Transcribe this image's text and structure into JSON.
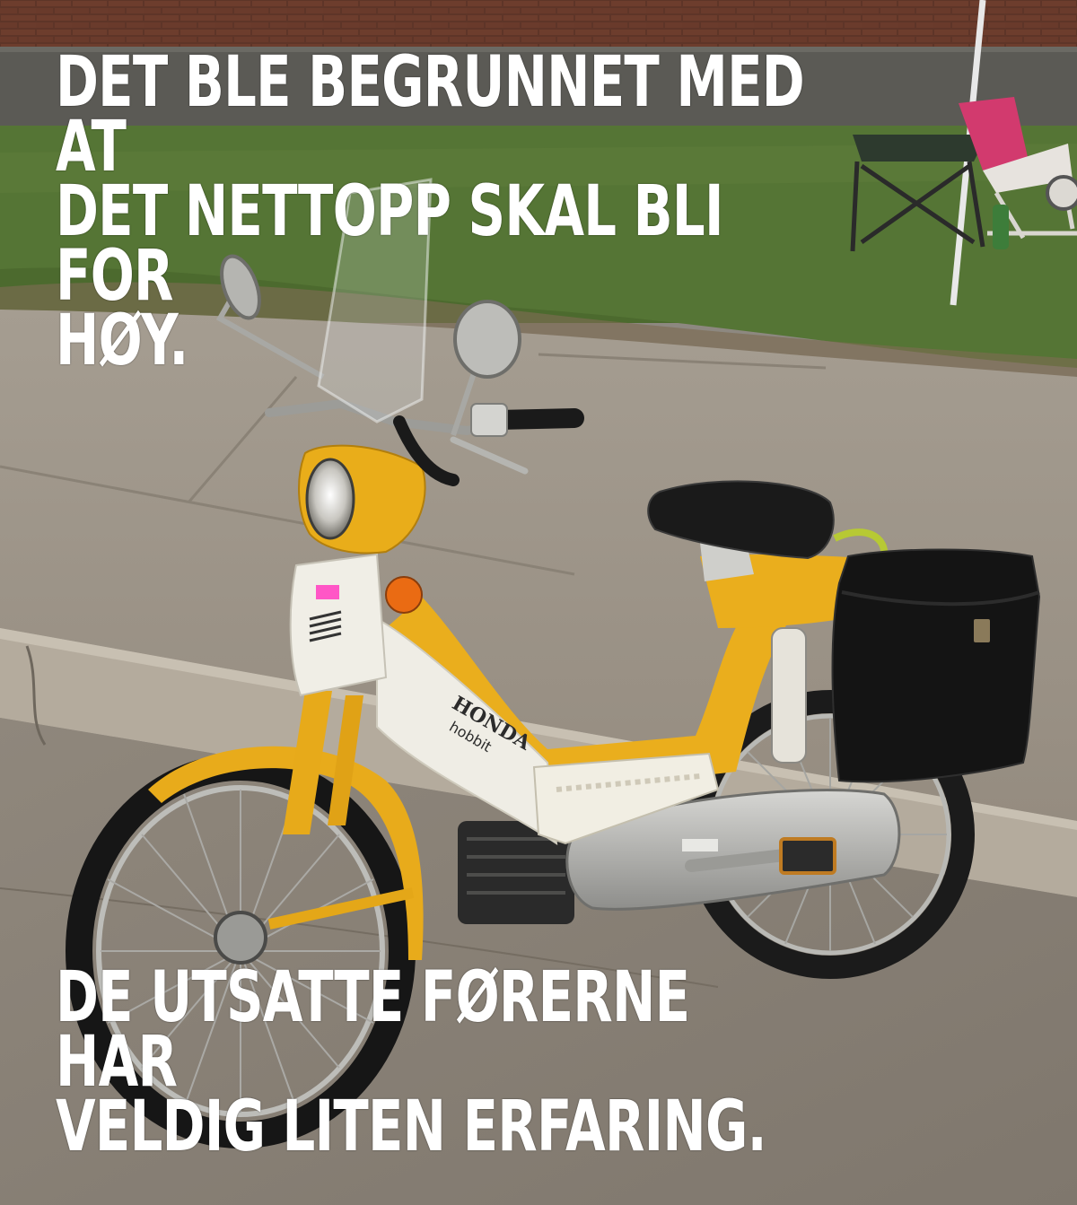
{
  "image": {
    "subject": "yellow-white-moped",
    "colors": {
      "brick": "#5a3328",
      "grass": "#4f6a2f",
      "concrete": "#a39a8d",
      "moped_yellow": "#e9ad1a",
      "moped_white": "#eeece4",
      "black": "#141414"
    }
  },
  "captions": {
    "top_lines": [
      "DET BLE BEGRUNNET MED AT",
      "DET NETTOPP SKAL BLI FOR",
      "HØY."
    ],
    "bottom_lines": [
      "DE UTSATTE FØRERNE HAR",
      "VELDIG LITEN ERFARING."
    ]
  },
  "logo": {
    "text": "HONDA",
    "model": "hobbit"
  }
}
